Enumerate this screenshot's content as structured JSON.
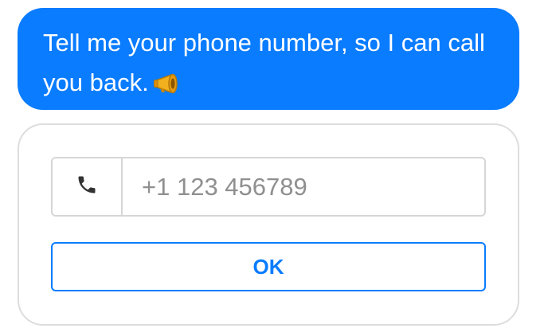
{
  "message": {
    "text": "Tell me your phone number, so I can call you back.",
    "emoji": "megaphone"
  },
  "form": {
    "phone_icon": "phone-icon",
    "phone_placeholder": "+1 123 456789",
    "phone_value": "",
    "ok_label": "OK"
  },
  "colors": {
    "accent": "#0a7cff",
    "border": "#d6d6d6",
    "card_border": "#dddddd",
    "placeholder": "#8f8f8f",
    "icon": "#333333"
  }
}
